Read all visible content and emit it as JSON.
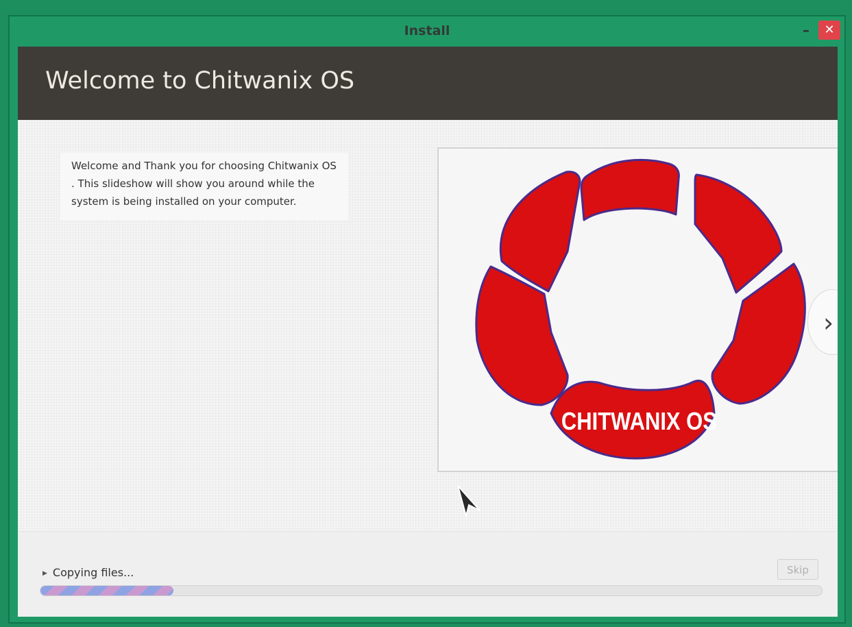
{
  "window": {
    "title": "Install",
    "minimize_label": "–",
    "close_label": "✕"
  },
  "header": {
    "title": "Welcome to Chitwanix OS"
  },
  "slide": {
    "text": "Welcome and Thank you for choosing Chitwanix OS . This slideshow will show you around while the system is being installed on your computer.",
    "logo_text": "CHITWANIX OS",
    "next_label": "›"
  },
  "footer": {
    "status_text": "Copying files...",
    "skip_label": "Skip",
    "progress_percent": 17
  },
  "colors": {
    "desktop": "#1d8f5e",
    "header": "#3f3c38",
    "logo_red": "#d90f12",
    "logo_outline": "#4a2b8c",
    "close_button": "#e0434a"
  }
}
